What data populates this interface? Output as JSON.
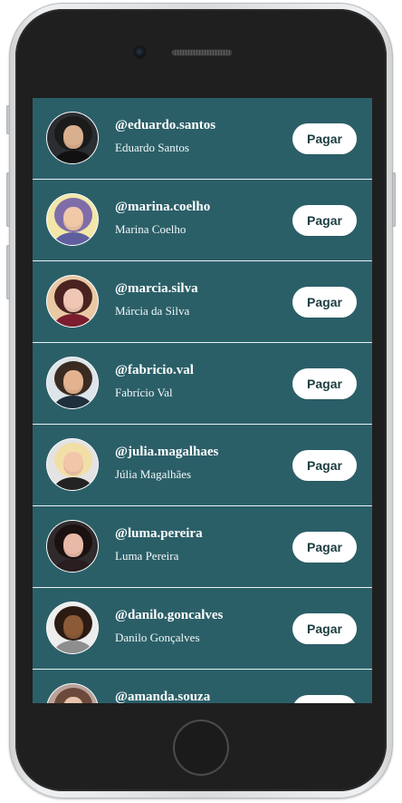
{
  "app": {
    "screen_background": "#2b5f68",
    "button_color": "#ffffff",
    "button_text_color": "#1d3d42"
  },
  "users": [
    {
      "handle": "@eduardo.santos",
      "name": "Eduardo Santos",
      "button_label": "Pagar",
      "avatar": {
        "background": "#2a2d31",
        "hair": "#1b1b1b",
        "skin": "#d9b08e",
        "shirt": "#111111"
      }
    },
    {
      "handle": "@marina.coelho",
      "name": "Marina Coelho",
      "button_label": "Pagar",
      "avatar": {
        "background": "#f2e7a8",
        "hair": "#7f6da9",
        "skin": "#f1c8a8",
        "shirt": "#5f5fa0"
      }
    },
    {
      "handle": "@marcia.silva",
      "name": "Márcia da Silva",
      "button_label": "Pagar",
      "avatar": {
        "background": "#e9c9a4",
        "hair": "#4a221f",
        "skin": "#f0c7b5",
        "shirt": "#7b1d2e"
      }
    },
    {
      "handle": "@fabricio.val",
      "name": "Fabrício Val",
      "button_label": "Pagar",
      "avatar": {
        "background": "#dde4ea",
        "hair": "#3a2b22",
        "skin": "#e3b28e",
        "shirt": "#1f2f3c"
      }
    },
    {
      "handle": "@julia.magalhaes",
      "name": "Júlia Magalhães",
      "button_label": "Pagar",
      "avatar": {
        "background": "#e3e3e3",
        "hair": "#f2dfa7",
        "skin": "#f2c6a9",
        "shirt": "#232323"
      }
    },
    {
      "handle": "@luma.pereira",
      "name": "Luma Pereira",
      "button_label": "Pagar",
      "avatar": {
        "background": "#2f2a2c",
        "hair": "#1b1111",
        "skin": "#e9b9a7",
        "shirt": "#2a1d1f"
      }
    },
    {
      "handle": "@danilo.goncalves",
      "name": "Danilo Gonçalves",
      "button_label": "Pagar",
      "avatar": {
        "background": "#ededed",
        "hair": "#2b1b12",
        "skin": "#8a5b36",
        "shirt": "#8e8e8e"
      }
    },
    {
      "handle": "@amanda.souza",
      "name": "",
      "button_label": "",
      "avatar": {
        "background": "#b9a39a",
        "hair": "#6b4a3b",
        "skin": "#e8c3ad",
        "shirt": "#5a4f4a"
      }
    }
  ]
}
